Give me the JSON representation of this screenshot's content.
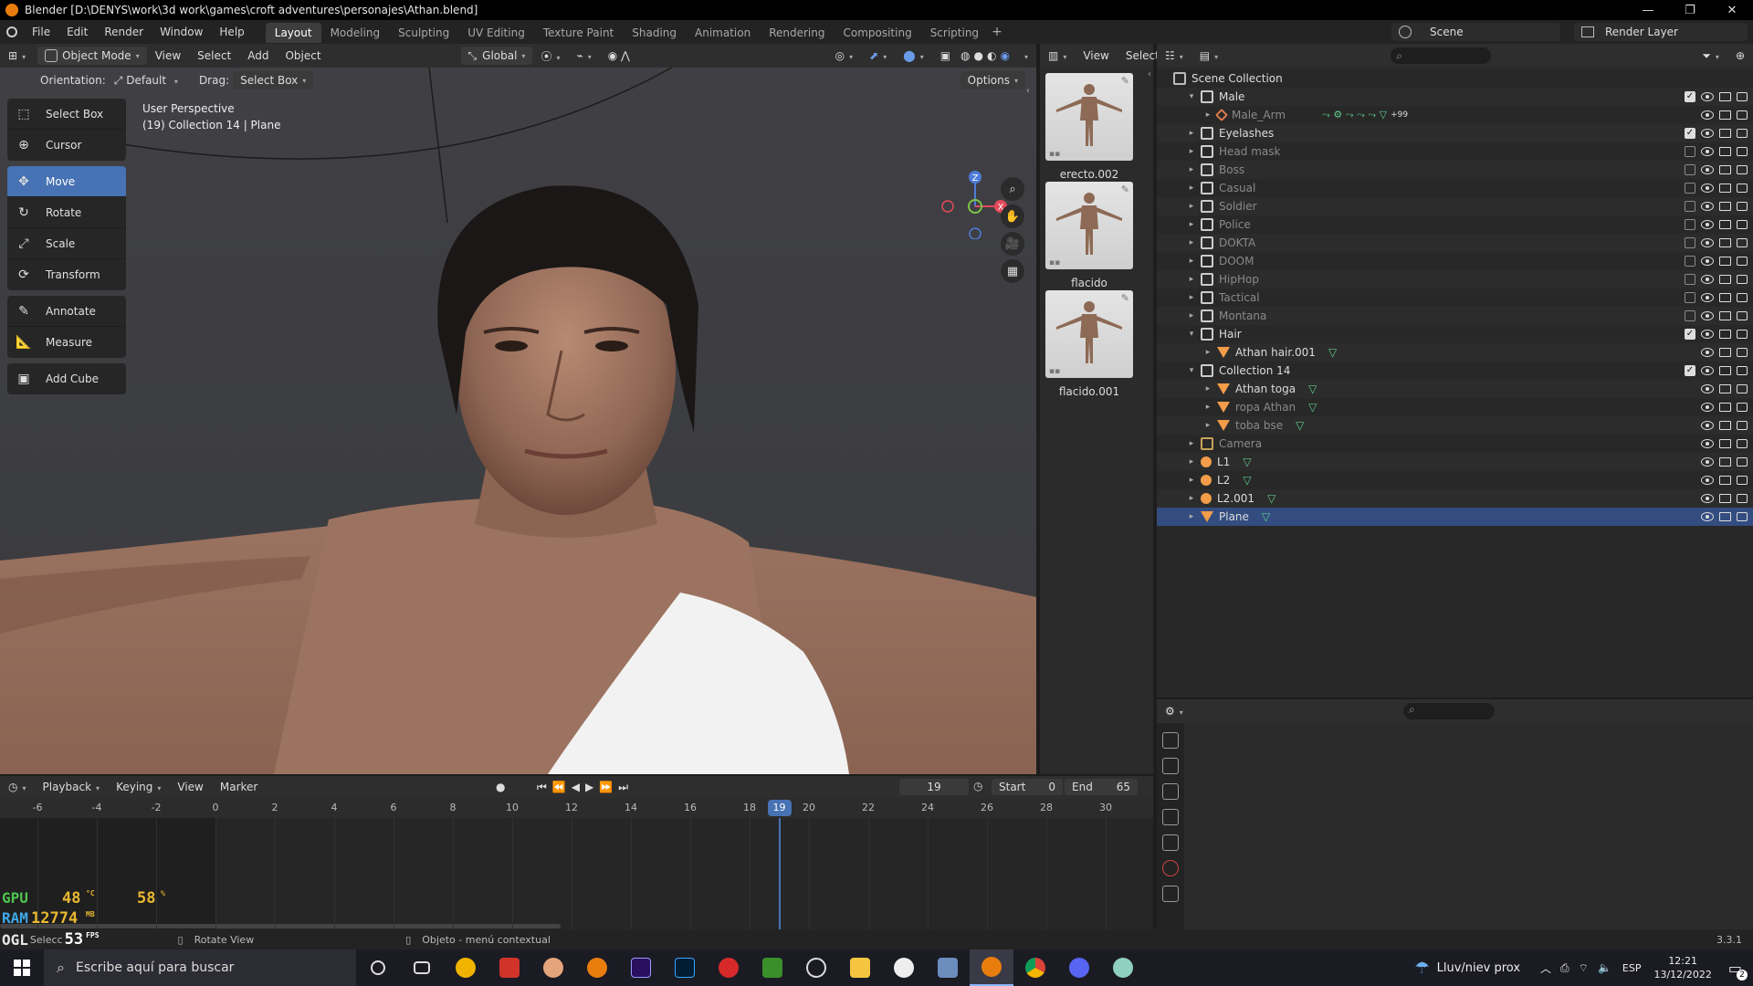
{
  "window": {
    "title": "Blender [D:\\DENYS\\work\\3d work\\games\\croft adventures\\personajes\\Athan.blend]"
  },
  "menus": [
    "File",
    "Edit",
    "Render",
    "Window",
    "Help"
  ],
  "workspaces": [
    "Layout",
    "Modeling",
    "Sculpting",
    "UV Editing",
    "Texture Paint",
    "Shading",
    "Animation",
    "Rendering",
    "Compositing",
    "Scripting"
  ],
  "active_workspace": "Layout",
  "scene": {
    "name": "Scene",
    "render_layer": "Render Layer"
  },
  "viewport": {
    "mode": "Object Mode",
    "header_menus": [
      "View",
      "Select",
      "Add",
      "Object"
    ],
    "transform_orientation": "Global",
    "orientation_label": "Orientation:",
    "orientation_value": "Default",
    "drag_label": "Drag:",
    "drag_value": "Select Box",
    "options_label": "Options",
    "perspective": "User Perspective",
    "context": "(19) Collection 14 | Plane",
    "gizmo_axes": {
      "x": "X",
      "y": "Y",
      "z": "Z"
    }
  },
  "toolbar": {
    "groups": [
      [
        {
          "label": "Select Box",
          "icon": "select-box-icon"
        },
        {
          "label": "Cursor",
          "icon": "cursor-icon"
        }
      ],
      [
        {
          "label": "Move",
          "icon": "move-icon",
          "active": true
        },
        {
          "label": "Rotate",
          "icon": "rotate-icon"
        },
        {
          "label": "Scale",
          "icon": "scale-icon"
        },
        {
          "label": "Transform",
          "icon": "transform-icon"
        }
      ],
      [
        {
          "label": "Annotate",
          "icon": "annotate-icon"
        },
        {
          "label": "Measure",
          "icon": "measure-icon"
        }
      ],
      [
        {
          "label": "Add Cube",
          "icon": "add-cube-icon"
        }
      ]
    ]
  },
  "asset_browser": {
    "header_menus": [
      "View",
      "Select"
    ],
    "items": [
      {
        "label": "erecto.002"
      },
      {
        "label": "flacido"
      },
      {
        "label": "flacido.001"
      }
    ]
  },
  "outliner": {
    "rows": [
      {
        "label": "Scene Collection",
        "type": "scene-collection",
        "depth": 0
      },
      {
        "label": "Male",
        "type": "collection",
        "depth": 1,
        "expanded": true,
        "checkbox": true
      },
      {
        "label": "Male_Arm",
        "type": "armature",
        "depth": 2,
        "dim": true,
        "extra": "+99"
      },
      {
        "label": "Eyelashes",
        "type": "collection",
        "depth": 1,
        "checkbox": true
      },
      {
        "label": "Head mask",
        "type": "collection",
        "depth": 1,
        "dim": true,
        "checkbox": false
      },
      {
        "label": "Boss",
        "type": "collection",
        "depth": 1,
        "dim": true,
        "checkbox": false
      },
      {
        "label": "Casual",
        "type": "collection",
        "depth": 1,
        "dim": true,
        "checkbox": false
      },
      {
        "label": "Soldier",
        "type": "collection",
        "depth": 1,
        "dim": true,
        "checkbox": false
      },
      {
        "label": "Police",
        "type": "collection",
        "depth": 1,
        "dim": true,
        "checkbox": false
      },
      {
        "label": "DOKTA",
        "type": "collection",
        "depth": 1,
        "dim": true,
        "checkbox": false
      },
      {
        "label": "DOOM",
        "type": "collection",
        "depth": 1,
        "dim": true,
        "checkbox": false
      },
      {
        "label": "HipHop",
        "type": "collection",
        "depth": 1,
        "dim": true,
        "checkbox": false
      },
      {
        "label": "Tactical",
        "type": "collection",
        "depth": 1,
        "dim": true,
        "checkbox": false
      },
      {
        "label": "Montana",
        "type": "collection",
        "depth": 1,
        "dim": true,
        "checkbox": false
      },
      {
        "label": "Hair",
        "type": "collection",
        "depth": 1,
        "expanded": true,
        "checkbox": true
      },
      {
        "label": "Athan hair.001",
        "type": "mesh",
        "depth": 2
      },
      {
        "label": "Collection 14",
        "type": "collection",
        "depth": 1,
        "expanded": true,
        "checkbox": true
      },
      {
        "label": "Athan toga",
        "type": "mesh",
        "depth": 2
      },
      {
        "label": "ropa Athan",
        "type": "mesh",
        "depth": 2,
        "dim": true
      },
      {
        "label": "toba bse",
        "type": "mesh",
        "depth": 2,
        "dim": true
      },
      {
        "label": "Camera",
        "type": "camera",
        "depth": 1,
        "dim": true
      },
      {
        "label": "L1",
        "type": "light",
        "depth": 1
      },
      {
        "label": "L2",
        "type": "light",
        "depth": 1
      },
      {
        "label": "L2.001",
        "type": "light",
        "depth": 1
      },
      {
        "label": "Plane",
        "type": "mesh",
        "depth": 1,
        "selected": true
      }
    ]
  },
  "timeline": {
    "menus": [
      "Playback",
      "Keying",
      "View",
      "Marker"
    ],
    "current_frame": "19",
    "start_label": "Start",
    "start": "0",
    "end_label": "End",
    "end": "65",
    "ticks": [
      "-6",
      "-4",
      "-2",
      "0",
      "2",
      "4",
      "6",
      "8",
      "10",
      "12",
      "14",
      "16",
      "18",
      "20",
      "22",
      "24",
      "26",
      "28",
      "30"
    ]
  },
  "overlay_stats": {
    "gpu_label": "GPU",
    "gpu_temp": "48",
    "gpu_temp_unit": "°C",
    "gpu_load": "58",
    "gpu_load_unit": "%",
    "ram_label": "RAM",
    "ram_value": "12774",
    "ram_unit": "MB",
    "ogl_label": "OGL",
    "fps_value": "53",
    "fps_unit": "FPS"
  },
  "statusbar": {
    "select": "Selecc",
    "rotate": "Rotate View",
    "context_menu": "Objeto - menú contextual",
    "version": "3.3.1"
  },
  "taskbar": {
    "search_placeholder": "Escribe aquí para buscar",
    "weather": "Lluv/niev prox",
    "lang": "ESP",
    "time": "12:21",
    "date": "13/12/2022",
    "notification_count": "2"
  },
  "colors": {
    "accent": "#4772b3",
    "selection": "#334d80",
    "blender_orange": "#e87d0d"
  }
}
